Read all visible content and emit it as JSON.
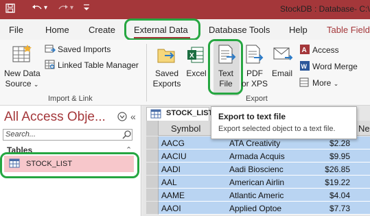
{
  "window": {
    "title": "StockDB : Database- C:\\"
  },
  "tabs": [
    {
      "label": "File"
    },
    {
      "label": "Home"
    },
    {
      "label": "Create"
    },
    {
      "label": "External Data"
    },
    {
      "label": "Database Tools"
    },
    {
      "label": "Help"
    },
    {
      "label": "Table Field"
    }
  ],
  "ribbon": {
    "import_group": {
      "label": "Import & Link",
      "new_data_source_line1": "New Data",
      "new_data_source_line2": "Source",
      "saved_imports": "Saved Imports",
      "linked_table_manager": "Linked Table Manager"
    },
    "export_group": {
      "label": "Export",
      "saved_exports_line1": "Saved",
      "saved_exports_line2": "Exports",
      "excel": "Excel",
      "text_file_line1": "Text",
      "text_file_line2": "File",
      "pdf_line1": "PDF",
      "pdf_line2": "or XPS",
      "email": "Email",
      "access": "Access",
      "word_merge": "Word Merge",
      "more": "More"
    }
  },
  "nav": {
    "title": "All Access Obje...",
    "search_placeholder": "Search...",
    "section": "Tables",
    "items": [
      {
        "label": "STOCK_LIST"
      }
    ]
  },
  "datasheet": {
    "tab_label": "STOCK_LIST",
    "columns": [
      "Symbol",
      "Ne"
    ],
    "rows": [
      {
        "symbol": "AACG",
        "name": "ATA Creativity",
        "price": "$2.28"
      },
      {
        "symbol": "AACIU",
        "name": "Armada Acquis",
        "price": "$9.95"
      },
      {
        "symbol": "AADI",
        "name": "Aadi Bioscienc",
        "price": "$26.85"
      },
      {
        "symbol": "AAL",
        "name": "American Airlin",
        "price": "$19.22"
      },
      {
        "symbol": "AAME",
        "name": "Atlantic Americ",
        "price": "$4.04"
      },
      {
        "symbol": "AAOI",
        "name": "Applied Optoe",
        "price": "$7.73"
      }
    ]
  },
  "tooltip": {
    "title": "Export to text file",
    "description": "Export selected object to a text file."
  },
  "colors": {
    "accent": "#a4373a",
    "highlight": "#26a641",
    "row_select": "#b9d4f2"
  }
}
